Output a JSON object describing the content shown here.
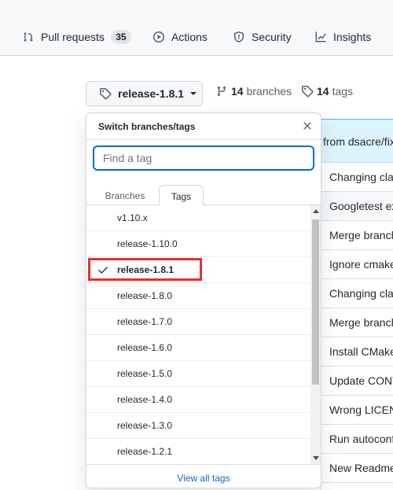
{
  "nav": {
    "pull_requests": "Pull requests",
    "pull_requests_count": "35",
    "actions": "Actions",
    "security": "Security",
    "insights": "Insights"
  },
  "toolbar": {
    "current_tag": "release-1.8.1",
    "branches_count": "14",
    "branches_label": "branches",
    "tags_count": "14",
    "tags_label": "tags"
  },
  "commit_header": "from dsacre/fix",
  "commits": [
    "Changing clar",
    "Googletest ex",
    "Merge branch",
    "Ignore cmake",
    "Changing clar",
    "Merge branch",
    "Install CMake",
    "Update CONT",
    "Wrong LICEN",
    "Run autoconf",
    "New Readme"
  ],
  "dropdown": {
    "title": "Switch branches/tags",
    "search_placeholder": "Find a tag",
    "tabs": [
      "Branches",
      "Tags"
    ],
    "active_tab": "Tags",
    "items": [
      "v1.10.x",
      "release-1.10.0",
      "release-1.8.1",
      "release-1.8.0",
      "release-1.7.0",
      "release-1.6.0",
      "release-1.5.0",
      "release-1.4.0",
      "release-1.3.0",
      "release-1.2.1"
    ],
    "selected_item": "release-1.8.1",
    "footer_link": "View all tags"
  },
  "colors": {
    "accent": "#0969da",
    "highlight": "#e5312f",
    "commit_header_bg": "#ddf4ff"
  }
}
